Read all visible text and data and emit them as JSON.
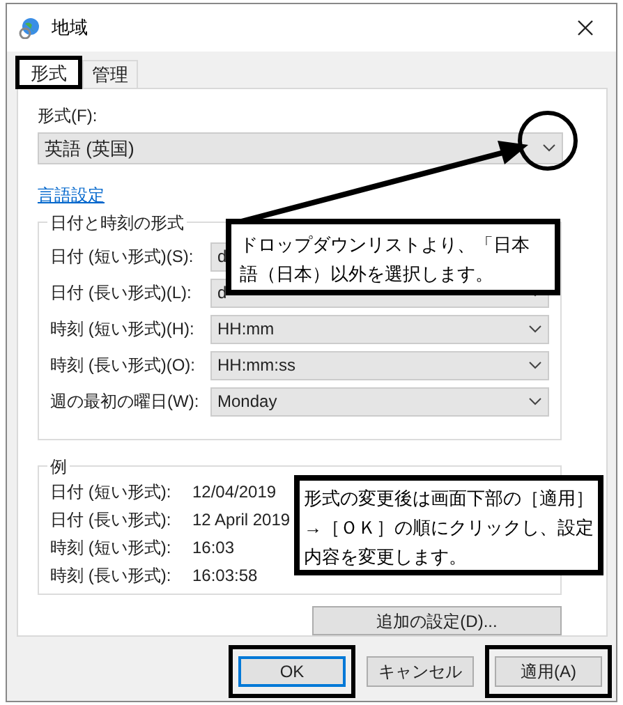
{
  "window": {
    "title": "地域"
  },
  "tabs": [
    {
      "label": "形式",
      "selected": true,
      "highlighted": true
    },
    {
      "label": "管理",
      "selected": false,
      "highlighted": false
    }
  ],
  "format": {
    "label": "形式(F):",
    "value": "英語 (英国)",
    "circled": true
  },
  "language_link": "言語設定",
  "date_time_formats": {
    "title": "日付と時刻の形式",
    "rows": [
      {
        "label": "日付 (短い形式)(S):",
        "value": "d"
      },
      {
        "label": "日付 (長い形式)(L):",
        "value": "d"
      },
      {
        "label": "時刻 (短い形式)(H):",
        "value": "HH:mm"
      },
      {
        "label": "時刻 (長い形式)(O):",
        "value": "HH:mm:ss"
      },
      {
        "label": "週の最初の曜日(W):",
        "value": "Monday"
      }
    ]
  },
  "examples": {
    "title": "例",
    "rows": [
      {
        "label": "日付 (短い形式):",
        "value": "12/04/2019"
      },
      {
        "label": "日付 (長い形式):",
        "value": "12 April 2019"
      },
      {
        "label": "時刻 (短い形式):",
        "value": "16:03"
      },
      {
        "label": "時刻 (長い形式):",
        "value": "16:03:58"
      }
    ]
  },
  "additional_button": "追加の設定(D)...",
  "buttons": [
    {
      "label": "OK",
      "default": true,
      "highlighted": true
    },
    {
      "label": "キャンセル",
      "default": false,
      "highlighted": false
    },
    {
      "label": "適用(A)",
      "default": false,
      "highlighted": true
    }
  ],
  "callouts": [
    {
      "text": "ドロップダウンリストより、「日本語（日本）以外を選択します。"
    },
    {
      "text": "形式の変更後は画面下部の［適用］→［ＯＫ］の順にクリックし、設定内容を変更します。"
    }
  ]
}
